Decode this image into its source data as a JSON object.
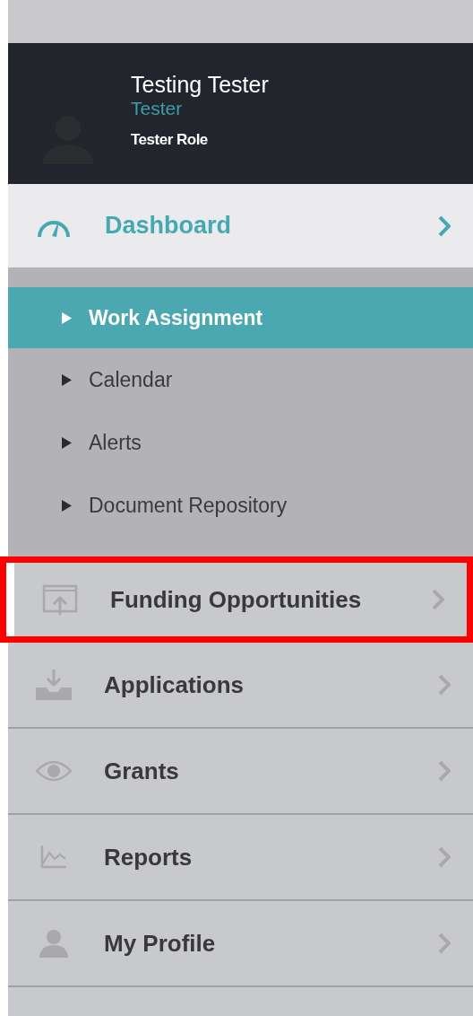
{
  "profile": {
    "name": "Testing Tester",
    "username": "Tester",
    "role": "Tester Role"
  },
  "dashboard": {
    "label": "Dashboard",
    "expanded": true
  },
  "submenu": [
    {
      "label": "Work Assignment",
      "selected": true
    },
    {
      "label": "Calendar",
      "selected": false
    },
    {
      "label": "Alerts",
      "selected": false
    },
    {
      "label": "Document Repository",
      "selected": false
    }
  ],
  "menu": [
    {
      "label": "Funding Opportunities",
      "highlighted": true
    },
    {
      "label": "Applications",
      "highlighted": false
    },
    {
      "label": "Grants",
      "highlighted": false
    },
    {
      "label": "Reports",
      "highlighted": false
    },
    {
      "label": "My Profile",
      "highlighted": false
    }
  ]
}
